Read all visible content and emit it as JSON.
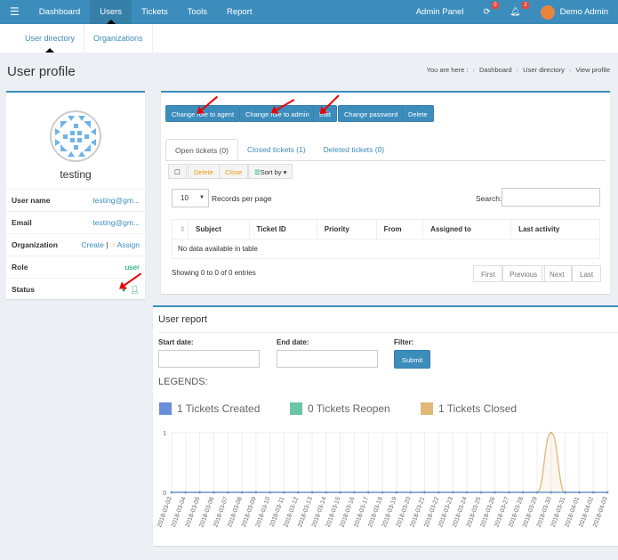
{
  "nav": {
    "items": [
      "Dashboard",
      "Users",
      "Tickets",
      "Tools",
      "Report"
    ],
    "active": "Users",
    "admin_panel": "Admin Panel",
    "refresh_badge": "0",
    "notif_badge": "2",
    "user": "Demo Admin"
  },
  "subnav": {
    "items": [
      "User directory",
      "Organizations"
    ]
  },
  "page_title": "User profile",
  "breadcrumb": {
    "prefix": "You are here :",
    "items": [
      "Dashboard",
      "User directory",
      "View profile"
    ]
  },
  "profile": {
    "name": "testing",
    "rows": [
      {
        "label": "User name",
        "value": "testing@gm..."
      },
      {
        "label": "Email",
        "value": "testing@gm..."
      },
      {
        "label": "Organization",
        "create": "Create",
        "sep": "|",
        "assign": "Assign"
      },
      {
        "label": "Role",
        "value": "user"
      },
      {
        "label": "Status"
      }
    ]
  },
  "actions": [
    "Change role to agent",
    "Change role to admin",
    "Edit",
    "Change password",
    "Delete"
  ],
  "tabs": [
    "Open tickets (0)",
    "Closed tickets (1)",
    "Deleted tickets (0)"
  ],
  "toolbar": {
    "delete": "Delete",
    "close": "Close",
    "sort": "Sort by"
  },
  "records": {
    "value": "10",
    "label": "Records per page"
  },
  "search_label": "Search:",
  "table": {
    "columns": [
      "Subject",
      "Ticket ID",
      "Priority",
      "From",
      "Assigned to",
      "Last activity"
    ],
    "empty": "No data available in table"
  },
  "showing": "Showing 0 to 0 of 0 entries",
  "pagination": [
    "First",
    "Previous",
    "Next",
    "Last"
  ],
  "report": {
    "title": "User report",
    "start": "Start date:",
    "end": "End date:",
    "filter": "Filter:",
    "submit": "Submit",
    "legends": "LEGENDS:"
  },
  "chart_data": {
    "type": "line",
    "x": [
      "2018-03-03",
      "2018-03-04",
      "2018-03-05",
      "2018-03-06",
      "2018-03-07",
      "2018-03-08",
      "2018-03-09",
      "2018-03-10",
      "2018-03-11",
      "2018-03-12",
      "2018-03-13",
      "2018-03-14",
      "2018-03-15",
      "2018-03-16",
      "2018-03-17",
      "2018-03-18",
      "2018-03-19",
      "2018-03-20",
      "2018-03-21",
      "2018-03-22",
      "2018-03-23",
      "2018-03-24",
      "2018-03-25",
      "2018-03-26",
      "2018-03-27",
      "2018-03-28",
      "2018-03-29",
      "2018-03-30",
      "2018-03-31",
      "2018-04-01",
      "2018-04-02",
      "2018-04-03"
    ],
    "ylim": [
      0,
      1
    ],
    "yticks": [
      "0",
      "1"
    ],
    "series": [
      {
        "name": "1 Tickets Created",
        "color": "#6a8fd9",
        "values": [
          0,
          0,
          0,
          0,
          0,
          0,
          0,
          0,
          0,
          0,
          0,
          0,
          0,
          0,
          0,
          0,
          0,
          0,
          0,
          0,
          0,
          0,
          0,
          0,
          0,
          0,
          0,
          0,
          0,
          0,
          0,
          0
        ]
      },
      {
        "name": "0 Tickets Reopen",
        "color": "#6cc4a7",
        "values": [
          0,
          0,
          0,
          0,
          0,
          0,
          0,
          0,
          0,
          0,
          0,
          0,
          0,
          0,
          0,
          0,
          0,
          0,
          0,
          0,
          0,
          0,
          0,
          0,
          0,
          0,
          0,
          0,
          0,
          0,
          0,
          0
        ]
      },
      {
        "name": "1 Tickets Closed",
        "color": "#e0b878",
        "values": [
          0,
          0,
          0,
          0,
          0,
          0,
          0,
          0,
          0,
          0,
          0,
          0,
          0,
          0,
          0,
          0,
          0,
          0,
          0,
          0,
          0,
          0,
          0,
          0,
          0,
          0,
          0,
          1,
          0,
          0,
          0,
          0
        ]
      }
    ]
  }
}
